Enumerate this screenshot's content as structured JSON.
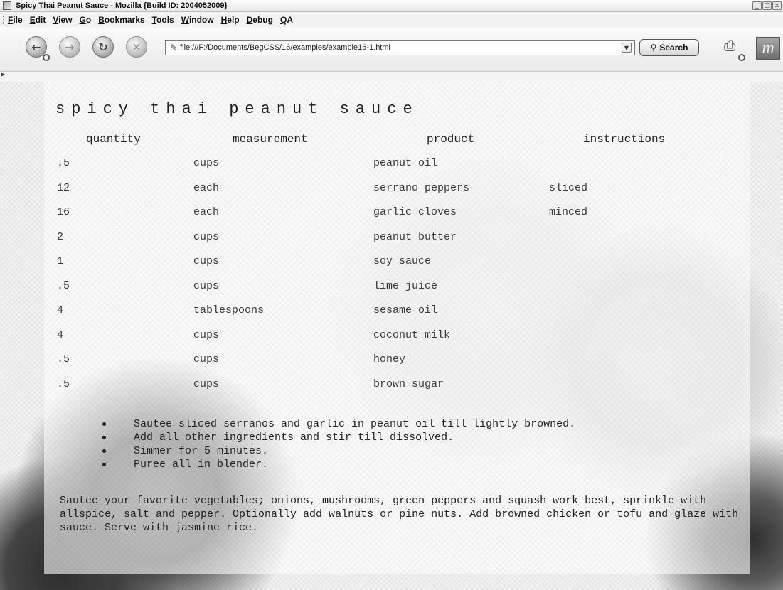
{
  "window": {
    "title": "Spicy Thai Peanut Sauce - Mozilla {Build ID: 2004052009}",
    "minimize": "_",
    "maximize": "□",
    "close": "x"
  },
  "menu": [
    "File",
    "Edit",
    "View",
    "Go",
    "Bookmarks",
    "Tools",
    "Window",
    "Help",
    "Debug",
    "QA"
  ],
  "toolbar": {
    "url": "file:///F:/Documents/BegCSS/16/examples/example16-1.html",
    "search_label": "Search"
  },
  "page": {
    "title": "spicy thai peanut sauce",
    "headers": {
      "quantity": "quantity",
      "measurement": "measurement",
      "product": "product",
      "instructions": "instructions"
    },
    "ingredients": [
      {
        "quantity": ".5",
        "measurement": "cups",
        "product": "peanut oil",
        "instructions": ""
      },
      {
        "quantity": "12",
        "measurement": "each",
        "product": "serrano peppers",
        "instructions": "sliced"
      },
      {
        "quantity": "16",
        "measurement": "each",
        "product": "garlic cloves",
        "instructions": "minced"
      },
      {
        "quantity": "2",
        "measurement": "cups",
        "product": "peanut butter",
        "instructions": ""
      },
      {
        "quantity": "1",
        "measurement": "cups",
        "product": "soy sauce",
        "instructions": ""
      },
      {
        "quantity": ".5",
        "measurement": "cups",
        "product": "lime juice",
        "instructions": ""
      },
      {
        "quantity": "4",
        "measurement": "tablespoons",
        "product": "sesame oil",
        "instructions": ""
      },
      {
        "quantity": "4",
        "measurement": "cups",
        "product": "coconut milk",
        "instructions": ""
      },
      {
        "quantity": ".5",
        "measurement": "cups",
        "product": "honey",
        "instructions": ""
      },
      {
        "quantity": ".5",
        "measurement": "cups",
        "product": "brown sugar",
        "instructions": ""
      }
    ],
    "steps": [
      "Sautee sliced serranos and garlic in peanut oil till lightly browned.",
      "Add all other ingredients and stir till dissolved.",
      "Simmer for 5 minutes.",
      "Puree all in blender."
    ],
    "notes": "Sautee your favorite vegetables; onions, mushrooms, green peppers and squash work best, sprinkle with allspice, salt and pepper. Optionally add walnuts or pine nuts. Add browned chicken or tofu and glaze with sauce. Serve with jasmine rice."
  }
}
